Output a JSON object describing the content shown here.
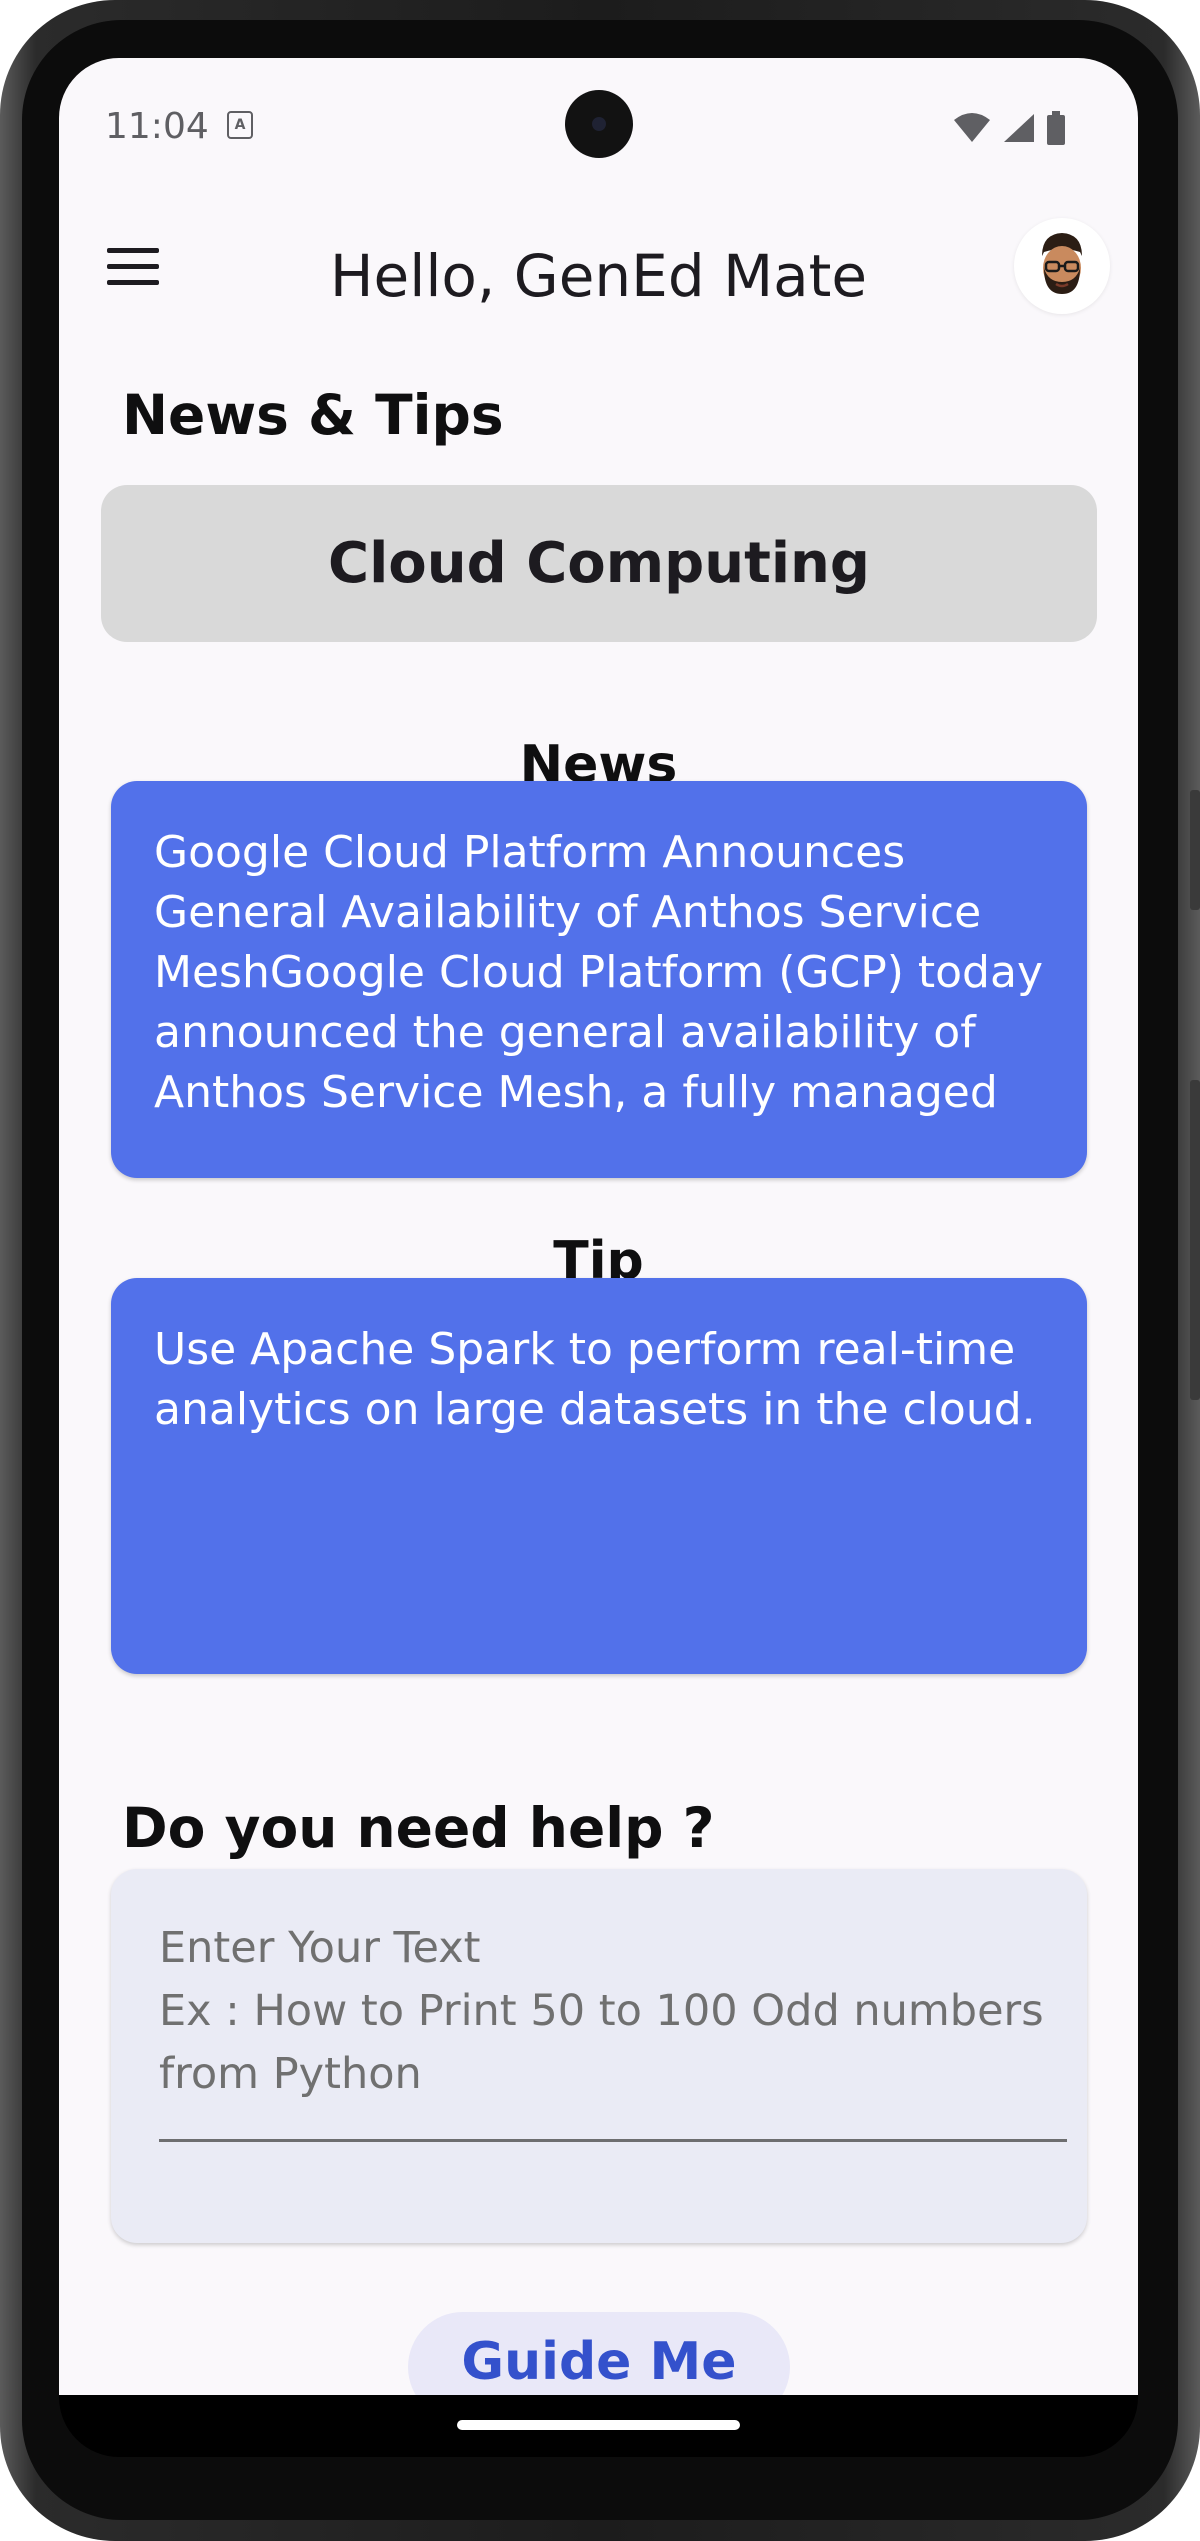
{
  "status_bar": {
    "time": "11:04",
    "notification_letter": "A",
    "icons": [
      "wifi-icon",
      "cell-signal-icon",
      "battery-icon"
    ]
  },
  "app_bar": {
    "title": "Hello, GenEd Mate",
    "menu_icon": "menu-icon",
    "avatar_icon": "avatar-memoji-icon"
  },
  "news_tips": {
    "heading": "News & Tips",
    "topic": "Cloud Computing",
    "news_heading": "News",
    "news_text": "Google Cloud Platform Announces General Availability of Anthos Service MeshGoogle Cloud Platform (GCP) today announced the general availability of Anthos Service Mesh, a fully managed",
    "tip_heading": "Tip",
    "tip_text": "Use Apache Spark to perform real-time analytics on large datasets in the cloud."
  },
  "help": {
    "heading": "Do you need help ?",
    "placeholder": "Enter Your Text\nEx : How to Print 50 to 100 Odd numbers from Python",
    "button_label": "Guide Me"
  },
  "colors": {
    "card_blue": "#5271ea",
    "topic_gray": "#d9d9d9",
    "button_text_blue": "#3451cc",
    "screen_bg": "#faf8fb"
  }
}
